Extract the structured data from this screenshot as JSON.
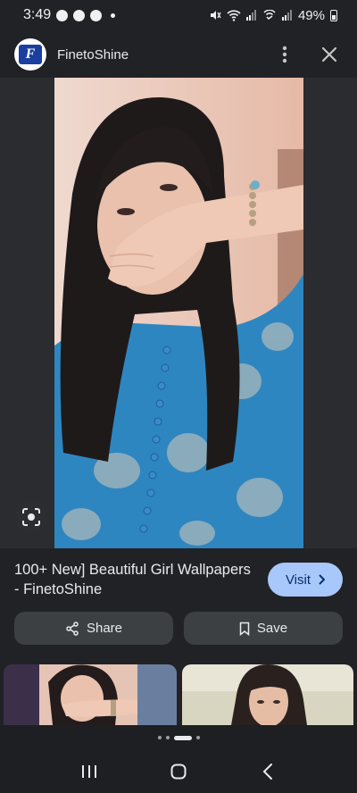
{
  "status_bar": {
    "time": "3:49",
    "battery": "49%",
    "icons": [
      "facebook-icon",
      "facebook-icon",
      "snapchat-icon",
      "mute-icon",
      "wifi-icon",
      "signal-icon",
      "wifi-calling-icon",
      "signal-icon",
      "battery-icon"
    ]
  },
  "header": {
    "site_name": "FinetoShine",
    "logo_letter": "F",
    "more_icon": "more-vert-icon",
    "close_icon": "close-icon"
  },
  "result": {
    "title": "100+ New] Beautiful Girl Wallpapers - FinetoShine",
    "visit_label": "Visit",
    "visit_icon": "chevron-right-icon"
  },
  "actions": {
    "share_label": "Share",
    "save_label": "Save"
  },
  "nav": {
    "recents_icon": "recents-icon",
    "home_icon": "home-icon",
    "back_icon": "back-icon"
  },
  "colors": {
    "background": "#212226",
    "visit_button": "#a8c7fa",
    "action_button": "#3c4043"
  }
}
